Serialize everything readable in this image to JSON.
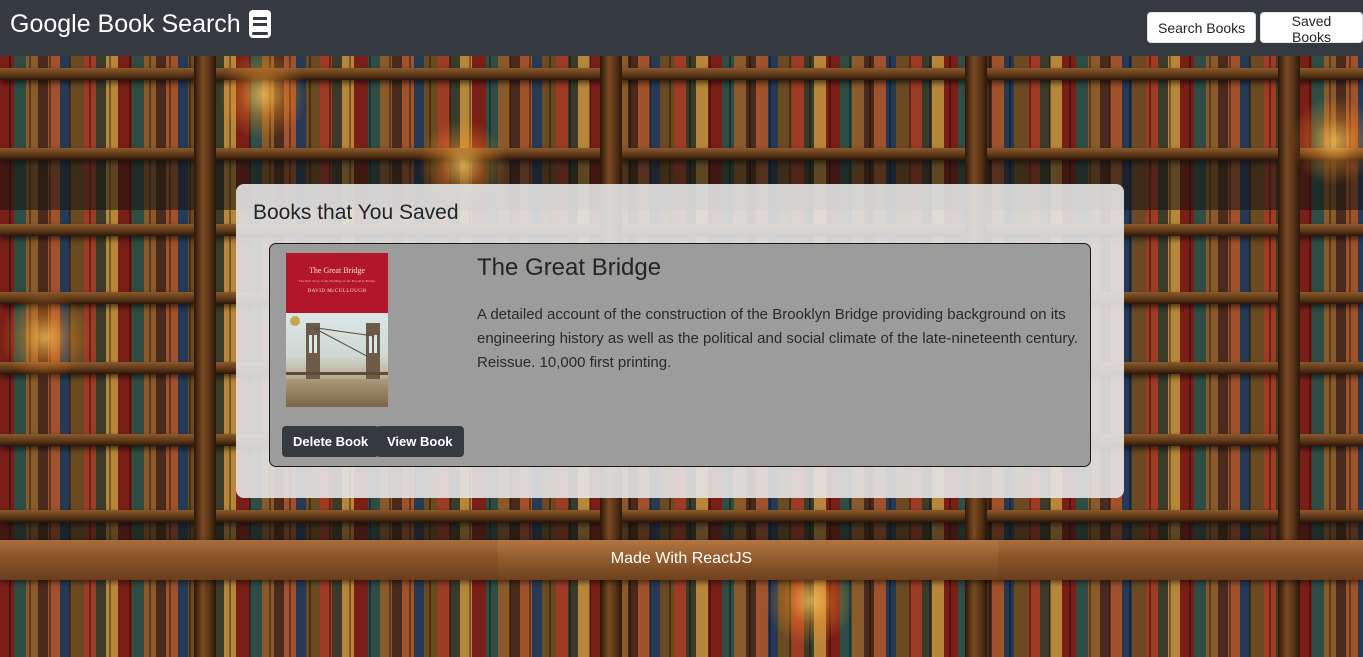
{
  "navbar": {
    "brand": "Google Book Search",
    "brand_icon": "book-icon",
    "search_label": "Search Books",
    "saved_label": "Saved Books",
    "bg_color": "#343a40"
  },
  "panel": {
    "title": "Books that You Saved"
  },
  "saved_books": [
    {
      "title": "The Great Bridge",
      "description": "A detailed account of the construction of the Brooklyn Bridge providing background on its engineering history as well as the political and social climate of the late-nineteenth century. Reissue. 10,000 first printing.",
      "cover": {
        "title": "The Great Bridge",
        "subtitle": "The Epic Story of the Building of the Brooklyn Bridge",
        "author": "DAVID McCULLOUGH"
      },
      "delete_label": "Delete Book",
      "view_label": "View Book"
    }
  ],
  "footer": {
    "text": "Made With ReactJS"
  }
}
